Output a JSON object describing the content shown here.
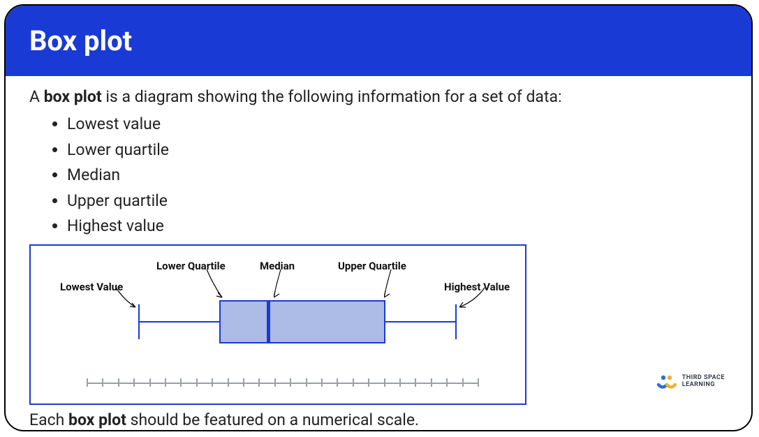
{
  "title": "Box plot",
  "intro_pre": "A ",
  "intro_bold": "box plot",
  "intro_post": " is a diagram showing the following information for a set of data:",
  "list": {
    "i0": "Lowest value",
    "i1": "Lower quartile",
    "i2": "Median",
    "i3": "Upper quartile",
    "i4": "Highest value"
  },
  "diagram": {
    "lowest": "Lowest Value",
    "lq": "Lower Quartile",
    "median": "Median",
    "uq": "Upper Quartile",
    "highest": "Highest Value"
  },
  "outro_pre": "Each ",
  "outro_bold": "box plot",
  "outro_post": " should be featured on a numerical scale.",
  "logo": {
    "line1": "THIRD SPACE",
    "line2": "LEARNING"
  },
  "chart_data": {
    "type": "boxplot",
    "title": "",
    "labels": [
      "Lowest Value",
      "Lower Quartile",
      "Median",
      "Upper Quartile",
      "Highest Value"
    ],
    "positions": [
      3,
      8,
      11,
      18,
      22
    ],
    "scale_ticks": 26,
    "xlabel": "",
    "ylabel": ""
  }
}
